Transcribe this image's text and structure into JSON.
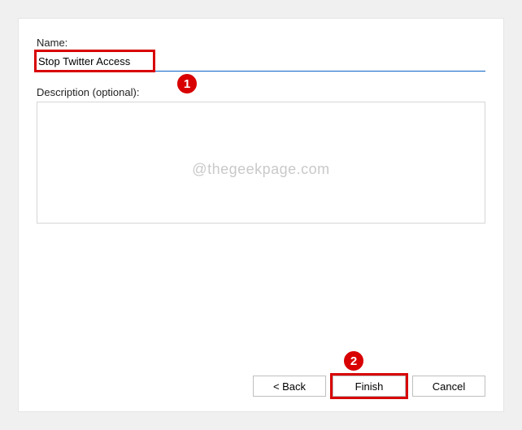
{
  "form": {
    "name_label": "Name:",
    "name_value": "Stop Twitter Access",
    "description_label": "Description (optional):",
    "description_value": ""
  },
  "buttons": {
    "back": "< Back",
    "finish": "Finish",
    "cancel": "Cancel"
  },
  "annotations": {
    "badge1": "1",
    "badge2": "2"
  },
  "watermark": "@thegeekpage.com",
  "colors": {
    "highlight": "#d80000",
    "input_underline": "#0a63c9"
  }
}
